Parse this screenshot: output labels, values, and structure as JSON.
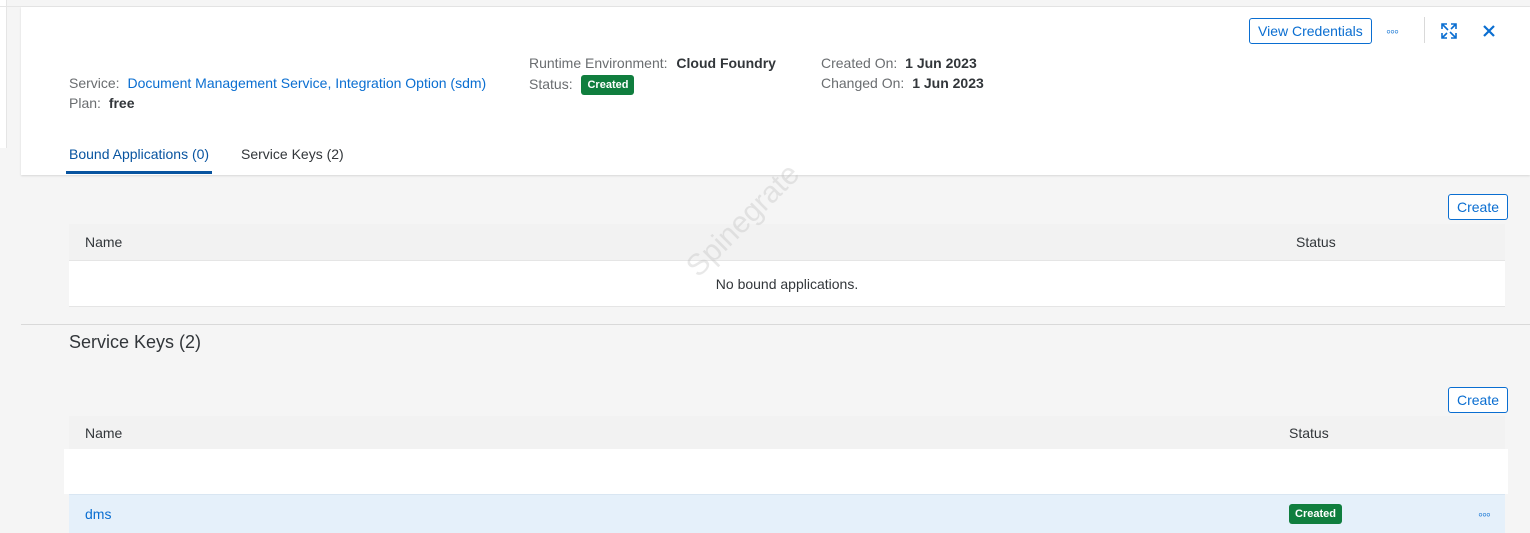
{
  "header": {
    "service_label": "Service:",
    "service_value": "Document Management Service, Integration Option (sdm)",
    "plan_label": "Plan:",
    "plan_value": "free",
    "runtime_label": "Runtime Environment:",
    "runtime_value": "Cloud Foundry",
    "status_label": "Status:",
    "status_value": "Created",
    "created_label": "Created On:",
    "created_value": "1 Jun 2023",
    "changed_label": "Changed On:",
    "changed_value": "1 Jun 2023"
  },
  "actions": {
    "view_credentials": "View Credentials",
    "more_icon": "overflow-icon",
    "expand_icon": "fullscreen-icon",
    "close_icon": "close-icon"
  },
  "tabs": [
    {
      "label": "Bound Applications (0)",
      "active": true
    },
    {
      "label": "Service Keys (2)",
      "active": false
    }
  ],
  "bound_apps": {
    "create_label": "Create",
    "columns": [
      "Name",
      "Status"
    ],
    "empty_text": "No bound applications."
  },
  "service_keys": {
    "title": "Service Keys (2)",
    "create_label": "Create",
    "columns": [
      "Name",
      "Status"
    ],
    "rows": [
      {
        "name": "dms",
        "status": "Created"
      }
    ]
  },
  "watermark": "Spinegrate",
  "colors": {
    "accent": "#0a6ed1",
    "success": "#107e3e",
    "row_highlight": "#e5f0fa"
  }
}
